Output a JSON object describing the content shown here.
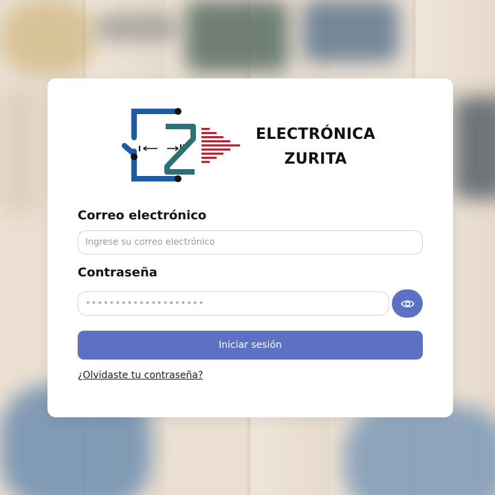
{
  "brand": {
    "line1": "ELECTRÓNICA",
    "line2": "ZURITA",
    "logo_icon": "circuit-logo-icon",
    "colors": {
      "blue": "#1f5aa6",
      "teal": "#2e6f78",
      "red": "#b3262e"
    }
  },
  "form": {
    "email_label": "Correo electrónico",
    "email_placeholder": "Ingrese su correo electrónico",
    "password_label": "Contraseña",
    "password_value": "••••••••••••••••••••",
    "show_password_icon": "eye-icon",
    "submit_label": "Iniciar sesión",
    "forgot_link": "¿Olvidaste tu contraseña?"
  },
  "colors": {
    "accent": "#5c70c4",
    "card": "#ffffff"
  }
}
